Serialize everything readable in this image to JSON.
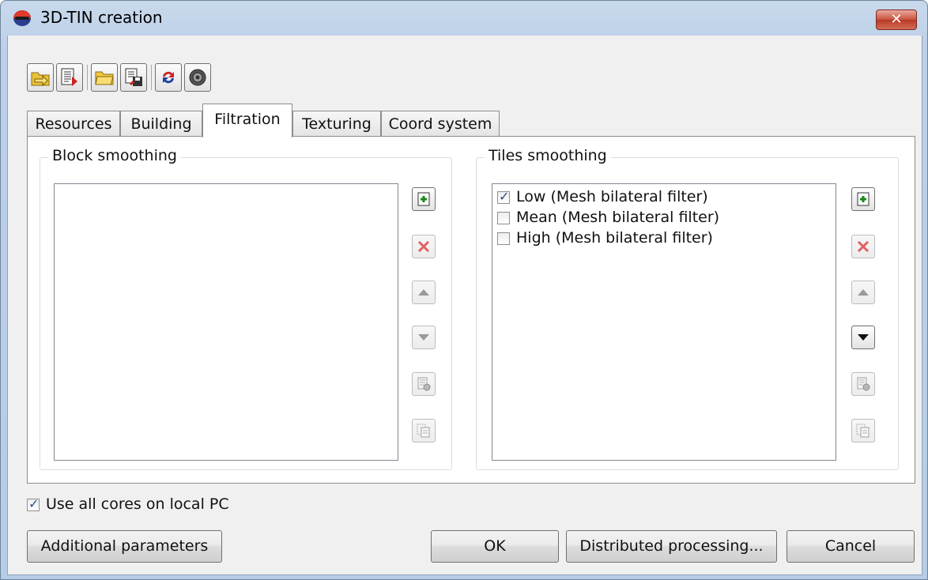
{
  "window": {
    "title": "3D-TIN creation",
    "close_label": "✕"
  },
  "toolbar": {
    "buttons": [
      {
        "icon": "open-arrow-icon"
      },
      {
        "icon": "save-list-icon"
      },
      {
        "icon": "open-folder-icon"
      },
      {
        "icon": "save-disk-icon"
      },
      {
        "icon": "refresh-icon"
      },
      {
        "icon": "settings-gear-icon"
      }
    ]
  },
  "tabs": [
    "Resources",
    "Building",
    "Filtration",
    "Texturing",
    "Coord system"
  ],
  "active_tab": "Filtration",
  "block_smoothing": {
    "label": "Block smoothing",
    "items": []
  },
  "tiles_smoothing": {
    "label": "Tiles smoothing",
    "items": [
      {
        "label": "Low (Mesh bilateral filter)",
        "checked": true
      },
      {
        "label": "Mean (Mesh bilateral filter)",
        "checked": false
      },
      {
        "label": "High (Mesh bilateral filter)",
        "checked": false
      }
    ]
  },
  "use_all_cores": {
    "label": "Use all cores on local PC",
    "checked": true
  },
  "buttons": {
    "additional": "Additional parameters",
    "ok": "OK",
    "distributed": "Distributed processing...",
    "cancel": "Cancel"
  },
  "colors": {
    "title_bar": "#bcd0e7",
    "close_button": "#c9513e",
    "add_icon": "#1a8a1a",
    "delete_icon": "#e06060"
  }
}
